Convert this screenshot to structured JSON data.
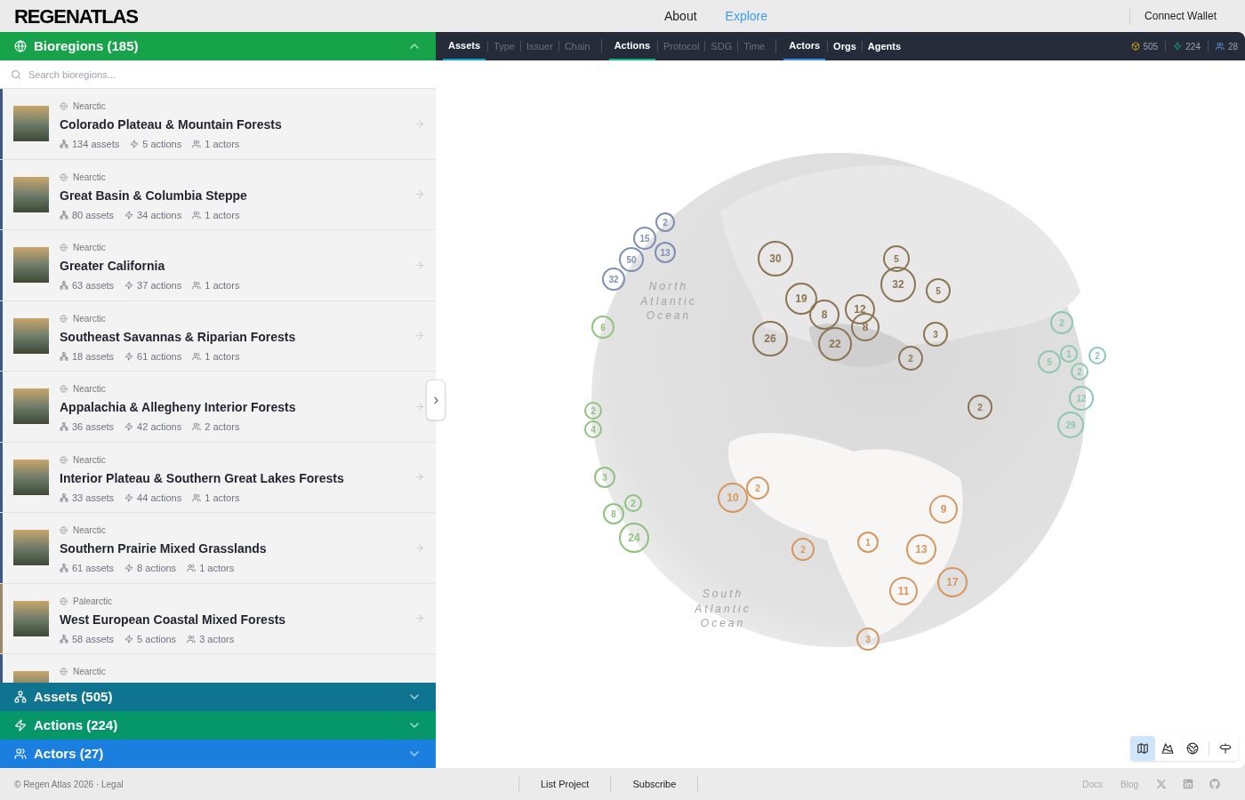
{
  "header": {
    "logo": "REGENATLAS",
    "nav": [
      {
        "label": "About",
        "selected": false
      },
      {
        "label": "Explore",
        "selected": true
      }
    ],
    "wallet": "Connect Wallet"
  },
  "sidebar": {
    "sections": [
      {
        "kind": "bioregions",
        "title": "Bioregions (185)",
        "expanded": true,
        "color": "#17a34a"
      },
      {
        "kind": "assets",
        "title": "Assets (505)",
        "expanded": false,
        "color": "#0f7490"
      },
      {
        "kind": "actions",
        "title": "Actions (224)",
        "expanded": false,
        "color": "#05966a"
      },
      {
        "kind": "actors",
        "title": "Actors (27)",
        "expanded": false,
        "color": "#1b7fe0"
      }
    ],
    "search": {
      "placeholder": "Search bioregions..."
    },
    "bioregions": [
      {
        "realm": "Nearctic",
        "name": "Colorado Plateau & Mountain Forests",
        "assets": "134 assets",
        "actions": "5 actions",
        "actors": "1 actors",
        "color": "#3d5a86"
      },
      {
        "realm": "Nearctic",
        "name": "Great Basin & Columbia Steppe",
        "assets": "80 assets",
        "actions": "34 actions",
        "actors": "1 actors",
        "color": "#3d5a86"
      },
      {
        "realm": "Nearctic",
        "name": "Greater California",
        "assets": "63 assets",
        "actions": "37 actions",
        "actors": "1 actors",
        "color": "#3d5a86"
      },
      {
        "realm": "Nearctic",
        "name": "Southeast Savannas & Riparian Forests",
        "assets": "18 assets",
        "actions": "61 actions",
        "actors": "1 actors",
        "color": "#3d5a86"
      },
      {
        "realm": "Nearctic",
        "name": "Appalachia & Allegheny Interior Forests",
        "assets": "36 assets",
        "actions": "42 actions",
        "actors": "2 actors",
        "color": "#3d5a86"
      },
      {
        "realm": "Nearctic",
        "name": "Interior Plateau & Southern Great Lakes Forests",
        "assets": "33 assets",
        "actions": "44 actions",
        "actors": "1 actors",
        "color": "#3d5a86"
      },
      {
        "realm": "Nearctic",
        "name": "Southern Prairie Mixed Grasslands",
        "assets": "61 assets",
        "actions": "8 actions",
        "actors": "1 actors",
        "color": "#3d5a86"
      },
      {
        "realm": "Palearctic",
        "name": "West European Coastal Mixed Forests",
        "assets": "58 assets",
        "actions": "5 actions",
        "actors": "3 actors",
        "color": "#9a8866"
      },
      {
        "realm": "Nearctic",
        "color": "#3d5a86"
      }
    ]
  },
  "map": {
    "tab_groups": [
      {
        "main": {
          "label": "Assets",
          "selected": true
        },
        "color": "#0ea5c6",
        "filters": [
          {
            "label": "Type",
            "enabled": false
          },
          {
            "label": "Issuer",
            "enabled": false
          },
          {
            "label": "Chain",
            "enabled": false
          }
        ]
      },
      {
        "main": {
          "label": "Actions",
          "selected": true
        },
        "color": "#10b981",
        "filters": [
          {
            "label": "Protocol",
            "enabled": false
          },
          {
            "label": "SDG",
            "enabled": false
          },
          {
            "label": "Time",
            "enabled": false
          }
        ]
      },
      {
        "main": {
          "label": "Actors",
          "selected": true
        },
        "color": "#3b8ef0",
        "filters": [
          {
            "label": "Orgs",
            "enabled": true
          },
          {
            "label": "Agents",
            "enabled": true
          }
        ]
      }
    ],
    "counts": [
      {
        "kind": "assets",
        "value": "505"
      },
      {
        "kind": "actions",
        "value": "224"
      },
      {
        "kind": "actors",
        "value": "28"
      }
    ],
    "oceans": [
      "North Atlantic Ocean",
      "South Atlantic Ocean"
    ],
    "markers": [
      {
        "label": "2",
        "color": "#7d8fb3"
      },
      {
        "label": "15",
        "color": "#7d8fb3"
      },
      {
        "label": "50",
        "color": "#7d8fb3"
      },
      {
        "label": "13",
        "color": "#7d8fb3"
      },
      {
        "label": "32",
        "color": "#7d8fb3"
      },
      {
        "label": "6",
        "color": "#8fc27e"
      },
      {
        "label": "2",
        "color": "#8fc27e"
      },
      {
        "label": "4",
        "color": "#8fc27e"
      },
      {
        "label": "3",
        "color": "#8fc27e"
      },
      {
        "label": "8",
        "color": "#8fc27e"
      },
      {
        "label": "2",
        "color": "#8fc27e"
      },
      {
        "label": "24",
        "color": "#8fc27e"
      },
      {
        "label": "30",
        "color": "#8b7452"
      },
      {
        "label": "5",
        "color": "#8b7452"
      },
      {
        "label": "32",
        "color": "#8b7452"
      },
      {
        "label": "5",
        "color": "#8b7452"
      },
      {
        "label": "19",
        "color": "#8b7452"
      },
      {
        "label": "8",
        "color": "#8b7452"
      },
      {
        "label": "12",
        "color": "#8b7452"
      },
      {
        "label": "8",
        "color": "#8b7452"
      },
      {
        "label": "26",
        "color": "#8b7452"
      },
      {
        "label": "22",
        "color": "#8b7452"
      },
      {
        "label": "3",
        "color": "#8b7452"
      },
      {
        "label": "2",
        "color": "#8b7452"
      },
      {
        "label": "2",
        "color": "#8b7452"
      },
      {
        "label": "2",
        "color": "#8cc7b0"
      },
      {
        "label": "5",
        "color": "#8cc7b0"
      },
      {
        "label": "1",
        "color": "#8cc7b0"
      },
      {
        "label": "2",
        "color": "#8cc7b0"
      },
      {
        "label": "2",
        "color": "#8cc7b0"
      },
      {
        "label": "12",
        "color": "#8cc7b0"
      },
      {
        "label": "29",
        "color": "#8cc7b0"
      },
      {
        "label": "10",
        "color": "#d6975e"
      },
      {
        "label": "2",
        "color": "#d6975e"
      },
      {
        "label": "2",
        "color": "#d6975e"
      },
      {
        "label": "1",
        "color": "#d6975e"
      },
      {
        "label": "9",
        "color": "#d6975e"
      },
      {
        "label": "13",
        "color": "#d6975e"
      },
      {
        "label": "11",
        "color": "#d6975e"
      },
      {
        "label": "17",
        "color": "#d6975e"
      },
      {
        "label": "3",
        "color": "#d6975e"
      }
    ],
    "views": [
      {
        "kind": "map",
        "selected": true
      },
      {
        "kind": "terrain",
        "selected": false
      },
      {
        "kind": "globe",
        "selected": false
      },
      {
        "kind": "signpost",
        "selected": false
      }
    ]
  },
  "footer": {
    "copyright": "© Regen Atlas 2026 · Legal",
    "links": [
      "List Project",
      "Subscribe"
    ],
    "right_links": [
      "Docs",
      "Blog"
    ],
    "socials": [
      {
        "kind": "x"
      },
      {
        "kind": "linkedin"
      },
      {
        "kind": "github"
      }
    ]
  }
}
